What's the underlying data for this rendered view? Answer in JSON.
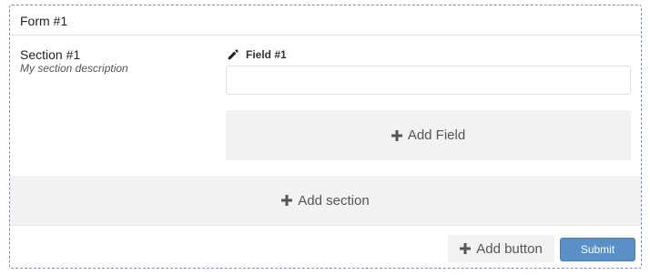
{
  "form": {
    "title": "Form #1"
  },
  "section": {
    "title": "Section #1",
    "description": "My section description"
  },
  "field": {
    "label": "Field #1",
    "value": "",
    "icon": "pencil-icon"
  },
  "actions": {
    "add_field_label": "Add Field",
    "add_section_label": "Add section",
    "add_button_label": "Add button",
    "submit_label": "Submit",
    "plus_icon": "plus-icon"
  },
  "colors": {
    "submit_background": "#5b8fc7",
    "placeholder_background": "#f2f2f2",
    "dashed_border": "#7d8ea6"
  }
}
